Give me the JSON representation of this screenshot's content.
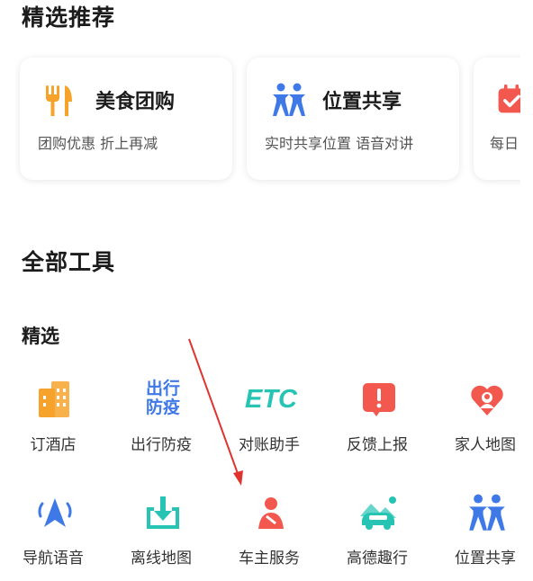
{
  "featured": {
    "title": "精选推荐",
    "cards": [
      {
        "icon": "fork-knife-icon",
        "title": "美食团购",
        "subtitle": "团购优惠 折上再减",
        "color": "#f7a32b"
      },
      {
        "icon": "two-people-icon",
        "title": "位置共享",
        "subtitle": "实时共享位置 语音对讲",
        "color": "#3f79e8"
      },
      {
        "icon": "calendar-check-icon",
        "title": "",
        "subtitle": "每日",
        "color": "#f2584e"
      }
    ]
  },
  "all_tools": {
    "title": "全部工具",
    "section_title": "精选",
    "row1": [
      {
        "icon": "hotel-building-icon",
        "label": "订酒店",
        "color": "#f7a32b"
      },
      {
        "icon": "travel-epidemic-text-icon",
        "label": "出行防疫",
        "icon_text_1": "出行",
        "icon_text_2": "防疫",
        "color": "#3f79e8"
      },
      {
        "icon": "etc-text-icon",
        "label": "对账助手",
        "icon_text": "ETC",
        "color": "#27c4b4"
      },
      {
        "icon": "feedback-alert-icon",
        "label": "反馈上报",
        "color": "#f2584e"
      },
      {
        "icon": "family-map-heart-icon",
        "label": "家人地图",
        "color": "#f2584e"
      }
    ],
    "row2": [
      {
        "icon": "navigation-voice-icon",
        "label": "导航语音",
        "color": "#3f79e8"
      },
      {
        "icon": "offline-map-download-icon",
        "label": "离线地图",
        "color": "#27c4b4"
      },
      {
        "icon": "car-owner-service-icon",
        "label": "车主服务",
        "color": "#f2584e"
      },
      {
        "icon": "amap-fun-trip-icon",
        "label": "高德趣行",
        "color": "#27c4b4"
      },
      {
        "icon": "location-share-people-icon",
        "label": "位置共享",
        "color": "#3f79e8"
      }
    ]
  },
  "annotation": {
    "arrow_color": "#e0322f"
  }
}
